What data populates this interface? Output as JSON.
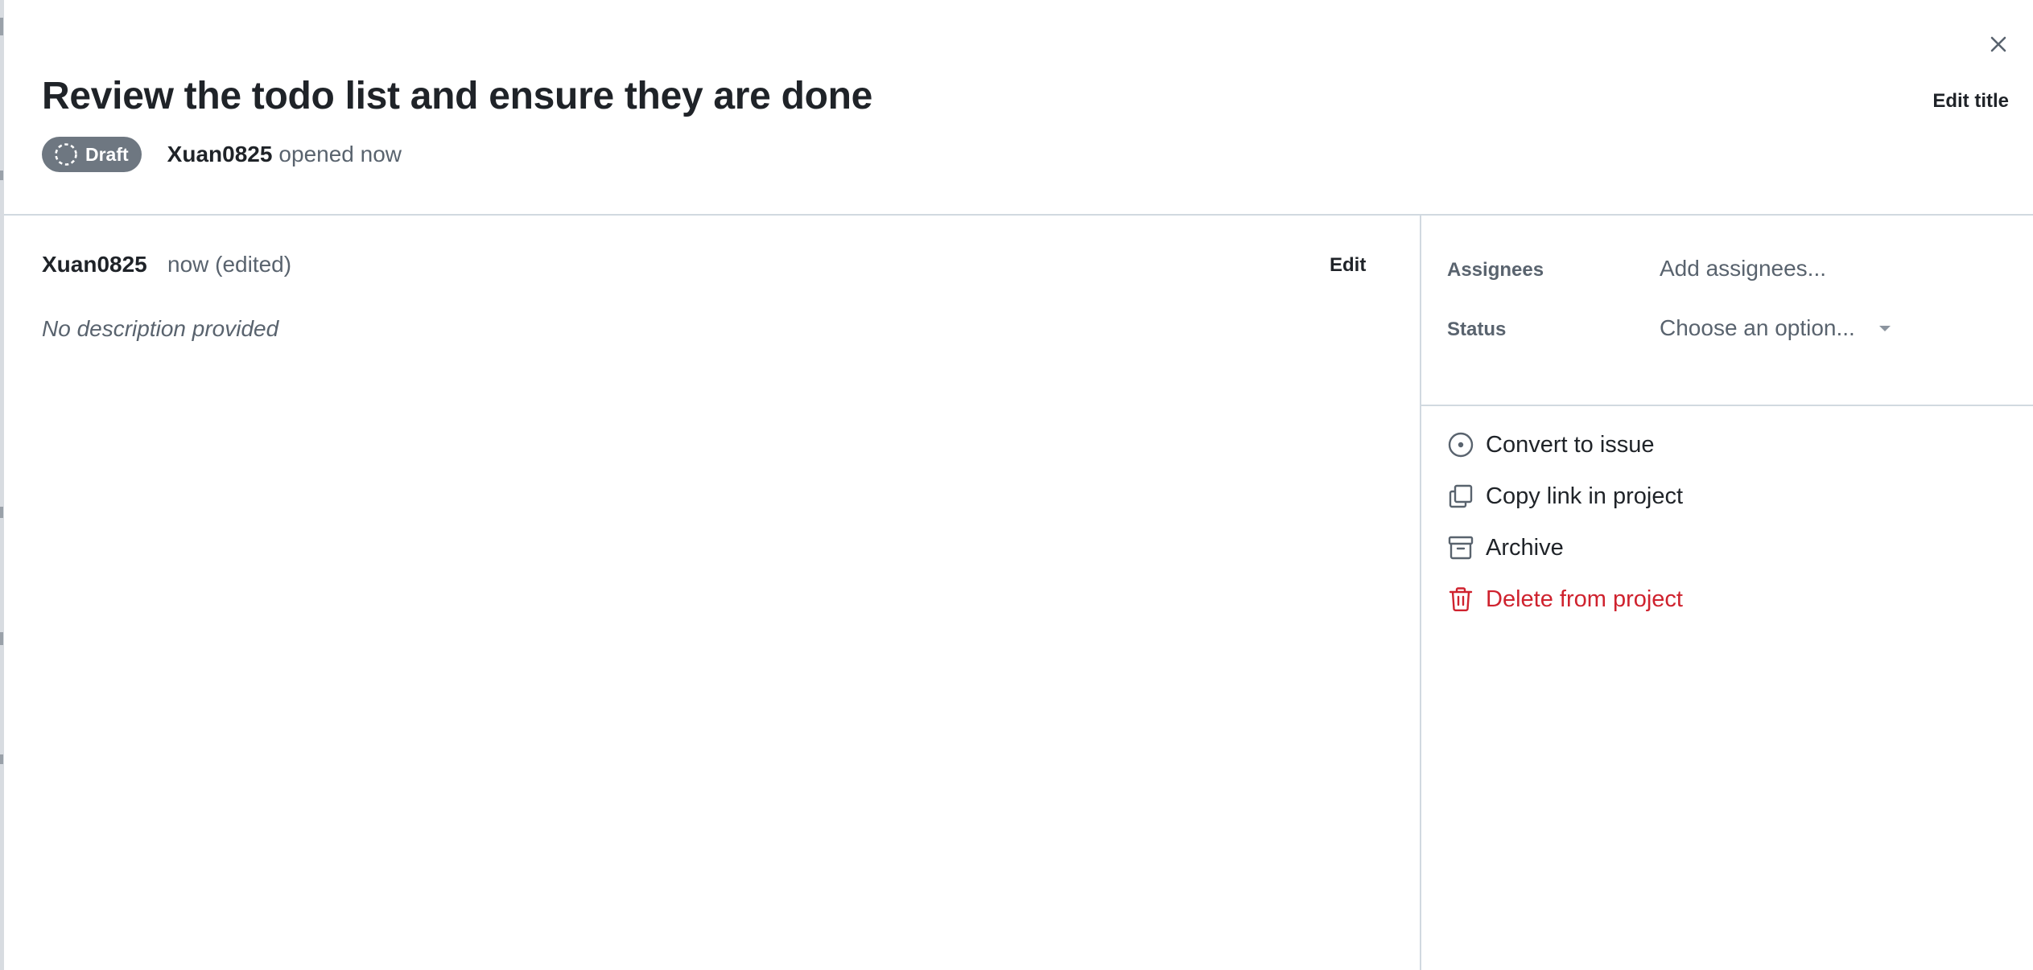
{
  "header": {
    "title": "Review the todo list and ensure they are done",
    "edit_title_label": "Edit title",
    "status_badge": "Draft",
    "author": "Xuan0825",
    "opened_text": "opened now"
  },
  "comment": {
    "author": "Xuan0825",
    "time": "now (edited)",
    "edit_label": "Edit",
    "body": "No description provided"
  },
  "sidebar": {
    "fields": [
      {
        "label": "Assignees",
        "value": "Add assignees..."
      },
      {
        "label": "Status",
        "value": "Choose an option..."
      }
    ],
    "actions": [
      {
        "label": "Convert to issue",
        "icon": "issue-opened-icon"
      },
      {
        "label": "Copy link in project",
        "icon": "copy-icon"
      },
      {
        "label": "Archive",
        "icon": "archive-icon"
      },
      {
        "label": "Delete from project",
        "icon": "trash-icon"
      }
    ]
  },
  "colors": {
    "danger": "#cf222e",
    "badge_bg": "#6e7781",
    "muted_text": "#59636e",
    "border": "#d1d9e0"
  }
}
